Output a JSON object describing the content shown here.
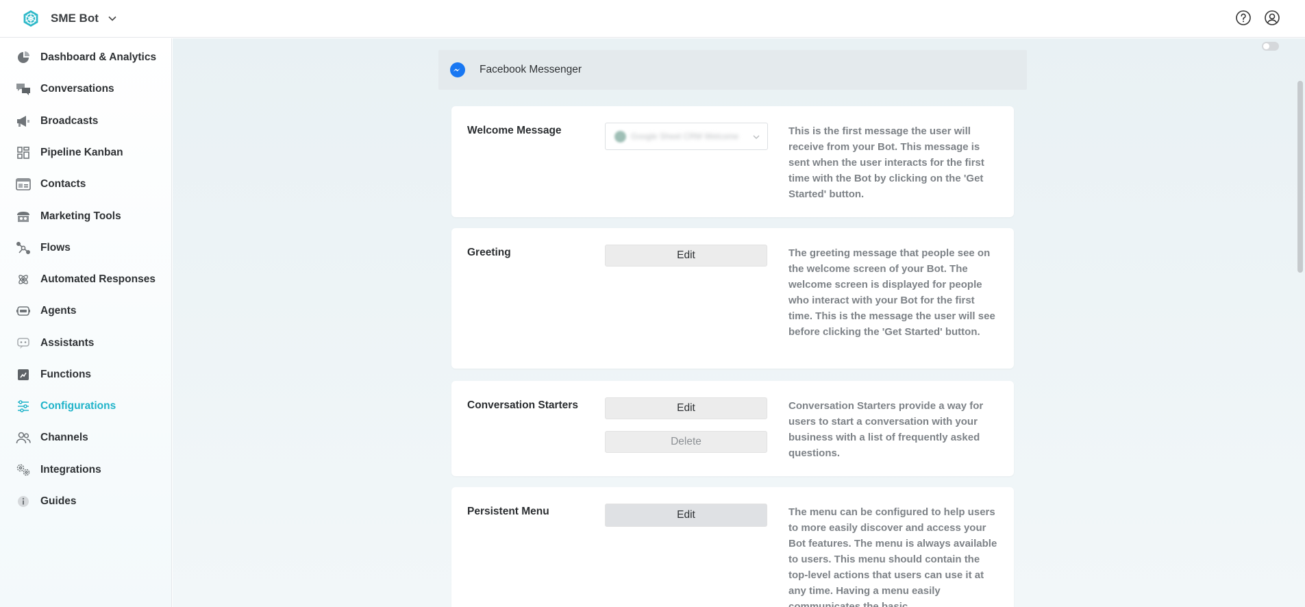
{
  "header": {
    "bot_name": "SME Bot",
    "icons": [
      "bot-logo-icon",
      "chevron-down-icon",
      "help-icon",
      "account-icon"
    ]
  },
  "sidebar": {
    "items": [
      {
        "label": "Dashboard & Analytics",
        "icon": "pie-chart-icon",
        "active": false
      },
      {
        "label": "Conversations",
        "icon": "chat-bubbles-icon",
        "active": false
      },
      {
        "label": "Broadcasts",
        "icon": "megaphone-icon",
        "active": false
      },
      {
        "label": "Pipeline Kanban",
        "icon": "kanban-icon",
        "active": false
      },
      {
        "label": "Contacts",
        "icon": "contact-card-icon",
        "active": false
      },
      {
        "label": "Marketing Tools",
        "icon": "store-icon",
        "active": false
      },
      {
        "label": "Flows",
        "icon": "flow-icon",
        "active": false
      },
      {
        "label": "Automated Responses",
        "icon": "atom-icon",
        "active": false
      },
      {
        "label": "Agents",
        "icon": "robot-icon",
        "active": false
      },
      {
        "label": "Assistants",
        "icon": "assistant-icon",
        "active": false
      },
      {
        "label": "Functions",
        "icon": "function-icon",
        "active": false
      },
      {
        "label": "Configurations",
        "icon": "sliders-icon",
        "active": true
      },
      {
        "label": "Channels",
        "icon": "users-icon",
        "active": false
      },
      {
        "label": "Integrations",
        "icon": "gears-icon",
        "active": false
      },
      {
        "label": "Guides",
        "icon": "info-icon",
        "active": false
      }
    ]
  },
  "main": {
    "channel": {
      "title": "Facebook Messenger",
      "icon": "messenger-icon"
    },
    "sections": {
      "welcome": {
        "title": "Welcome Message",
        "select_value": "Google Sheet CRM Welcome",
        "description": "This is the first message the user will receive from your Bot. This message is sent when the user interacts for the first time with the Bot by clicking on the 'Get Started' button."
      },
      "greeting": {
        "title": "Greeting",
        "edit_label": "Edit",
        "description": "The greeting message that people see on the welcome screen of your Bot. The welcome screen is displayed for people who interact with your Bot for the first time. This is the message the user will see before clicking the 'Get Started' button."
      },
      "starters": {
        "title": "Conversation Starters",
        "edit_label": "Edit",
        "delete_label": "Delete",
        "description": "Conversation Starters provide a way for users to start a conversation with your business with a list of frequently asked questions."
      },
      "menu": {
        "title": "Persistent Menu",
        "edit_label": "Edit",
        "description": "The menu can be configured to help users to more easily discover and access your Bot features. The menu is always available to users. This menu should contain the top-level actions that users can use it at any time. Having a menu easily communicates the basic"
      }
    }
  },
  "colors": {
    "accent": "#1fb3c9",
    "messenger": "#1877f2",
    "description_text": "#7d8287"
  }
}
